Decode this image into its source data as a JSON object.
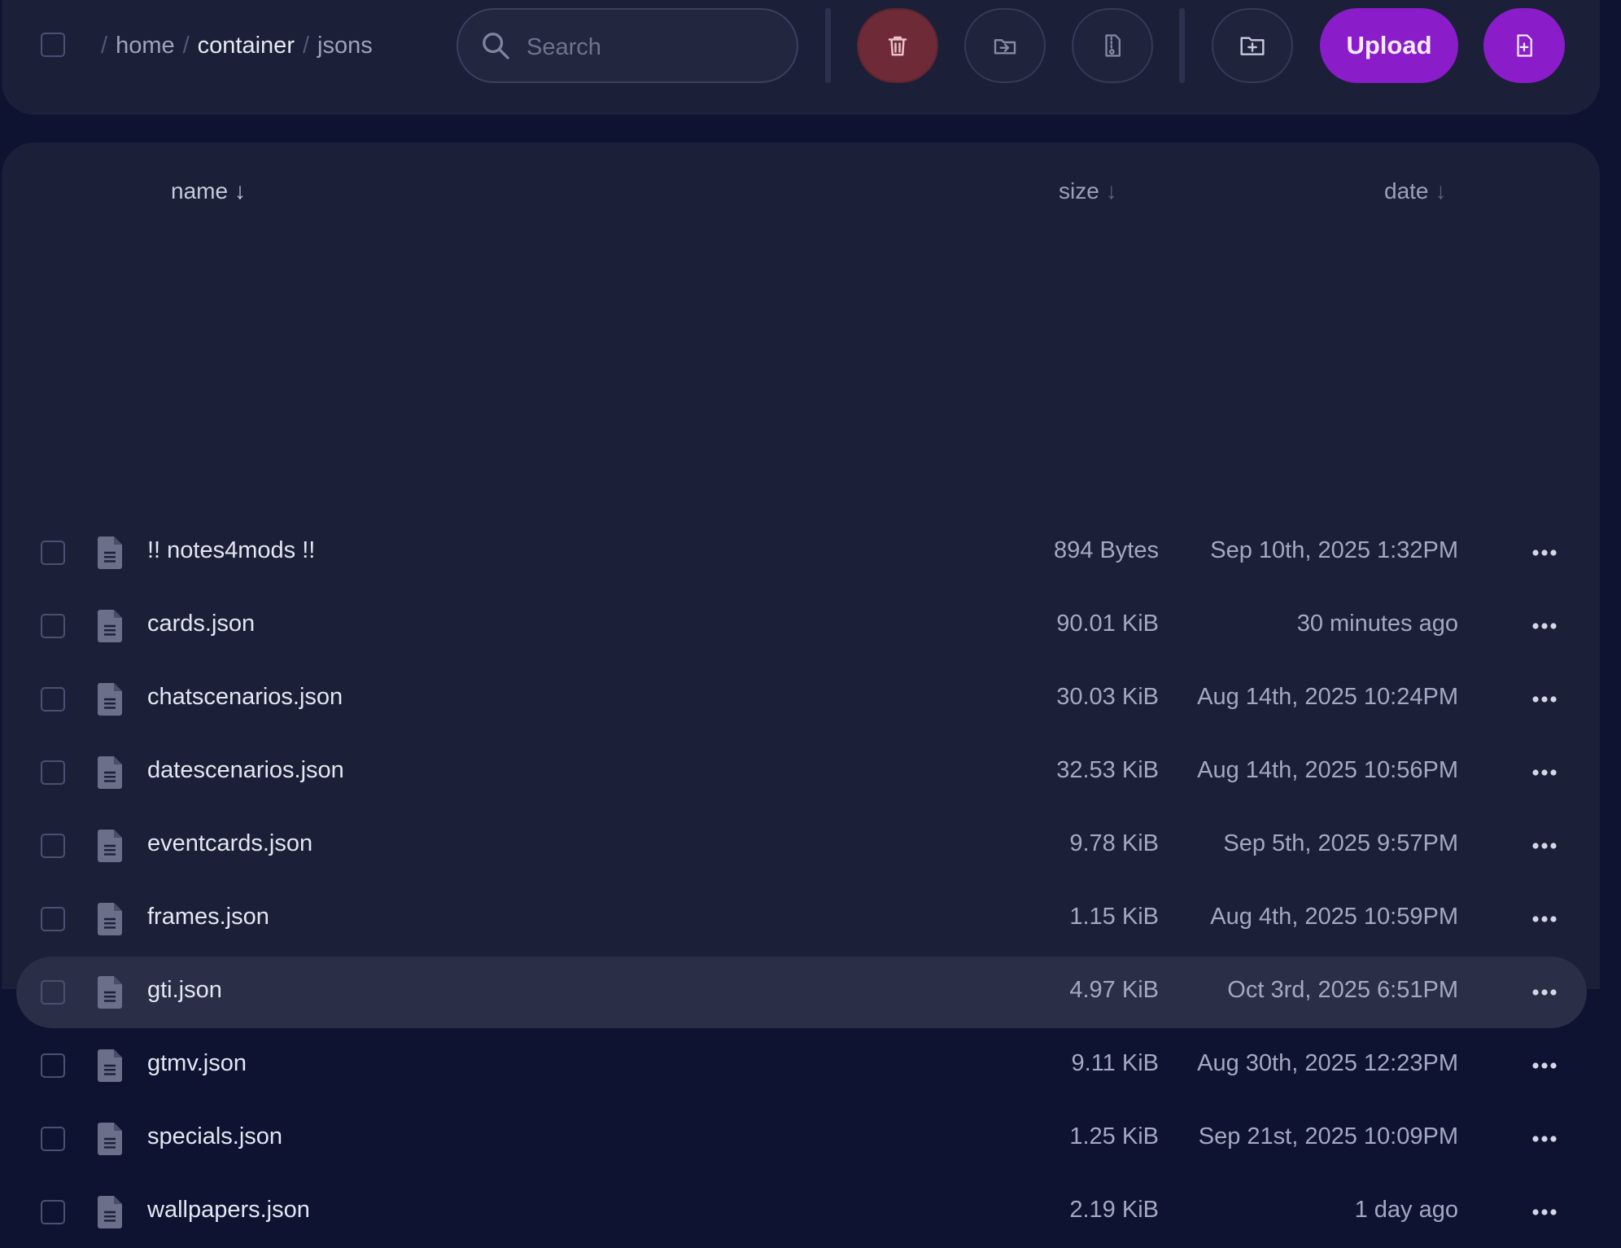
{
  "breadcrumb": {
    "items": [
      {
        "label": "home"
      },
      {
        "label": "container"
      },
      {
        "label": "jsons"
      }
    ],
    "separator": "/"
  },
  "search": {
    "placeholder": "Search",
    "value": ""
  },
  "toolbar": {
    "upload_label": "Upload",
    "buttons": [
      {
        "name": "delete",
        "icon": "trash-icon"
      },
      {
        "name": "move",
        "icon": "move-icon"
      },
      {
        "name": "archive",
        "icon": "archive-icon"
      },
      {
        "name": "new-folder",
        "icon": "folder-plus-icon"
      },
      {
        "name": "new-file",
        "icon": "file-plus-icon"
      }
    ]
  },
  "table": {
    "columns": {
      "name": "name",
      "size": "size",
      "date": "date",
      "sort_arrow": "↓"
    },
    "rows": [
      {
        "name": "!! notes4mods !!",
        "size": "894 Bytes",
        "date": "Sep 10th, 2025 1:32PM"
      },
      {
        "name": "cards.json",
        "size": "90.01 KiB",
        "date": "30 minutes ago"
      },
      {
        "name": "chatscenarios.json",
        "size": "30.03 KiB",
        "date": "Aug 14th, 2025 10:24PM"
      },
      {
        "name": "datescenarios.json",
        "size": "32.53 KiB",
        "date": "Aug 14th, 2025 10:56PM"
      },
      {
        "name": "eventcards.json",
        "size": "9.78 KiB",
        "date": "Sep 5th, 2025 9:57PM"
      },
      {
        "name": "frames.json",
        "size": "1.15 KiB",
        "date": "Aug 4th, 2025 10:59PM"
      },
      {
        "name": "gti.json",
        "size": "4.97 KiB",
        "date": "Oct 3rd, 2025 6:51PM",
        "highlighted": true
      },
      {
        "name": "gtmv.json",
        "size": "9.11 KiB",
        "date": "Aug 30th, 2025 12:23PM"
      },
      {
        "name": "specials.json",
        "size": "1.25 KiB",
        "date": "Sep 21st, 2025 10:09PM"
      },
      {
        "name": "wallpapers.json",
        "size": "2.19 KiB",
        "date": "1 day ago"
      }
    ]
  },
  "colors": {
    "background": "#0d1330",
    "panel": "#1b1f38",
    "accent": "#8a1cc9",
    "danger": "#6e2a36",
    "row_highlight": "#2a2e47"
  }
}
